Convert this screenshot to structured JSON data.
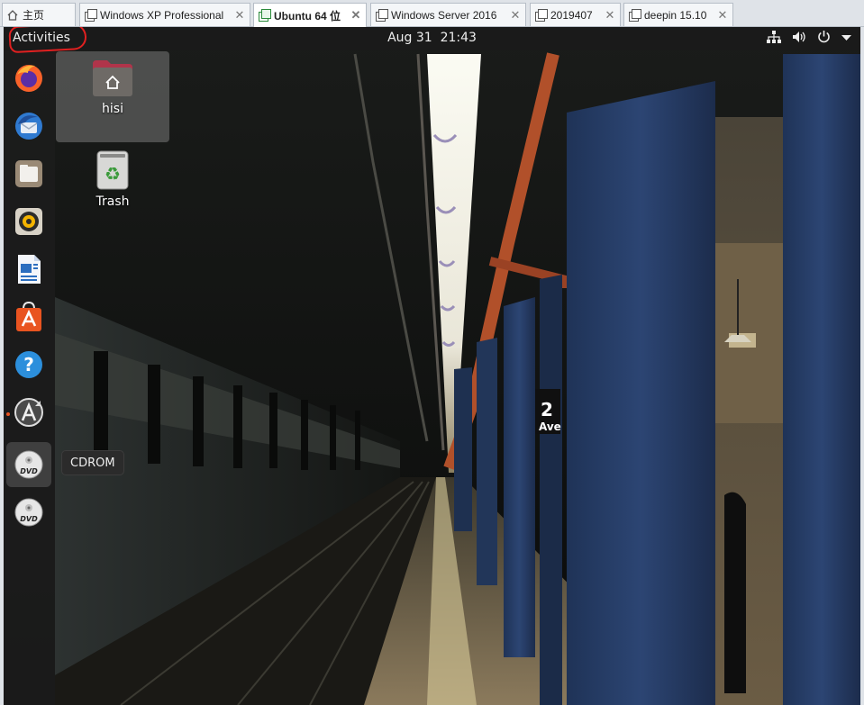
{
  "host_tabs": [
    {
      "label": "主页",
      "icon": "home-icon",
      "active": false
    },
    {
      "label": "Windows XP Professional",
      "icon": "vm-icon",
      "active": false
    },
    {
      "label": "Ubuntu 64 位",
      "icon": "vm-icon",
      "active": true
    },
    {
      "label": "Windows Server 2016",
      "icon": "vm-icon",
      "active": false
    },
    {
      "label": "2019407",
      "icon": "vm-icon",
      "active": false
    },
    {
      "label": "deepin 15.10",
      "icon": "vm-icon",
      "active": false
    }
  ],
  "topbar": {
    "activities_label": "Activities",
    "date": "Aug 31",
    "time": "21:43",
    "tray_icons": [
      "network-icon",
      "volume-icon",
      "power-icon",
      "dropdown-arrow-icon"
    ]
  },
  "dock": {
    "items": [
      {
        "name": "Firefox",
        "icon": "firefox-icon"
      },
      {
        "name": "Thunderbird",
        "icon": "thunderbird-icon"
      },
      {
        "name": "Files",
        "icon": "files-icon"
      },
      {
        "name": "Rhythmbox",
        "icon": "rhythmbox-icon"
      },
      {
        "name": "LibreOffice Writer",
        "icon": "writer-icon"
      },
      {
        "name": "Ubuntu Software",
        "icon": "software-icon"
      },
      {
        "name": "Help",
        "icon": "help-icon"
      },
      {
        "name": "Software Updater",
        "icon": "updater-icon",
        "running": true
      },
      {
        "name": "CDROM",
        "icon": "dvd-icon",
        "hovered": true
      },
      {
        "name": "CDROM",
        "icon": "dvd-icon"
      }
    ],
    "tooltip": "CDROM"
  },
  "desktop": {
    "home_folder_label": "hisi",
    "trash_label": "Trash"
  },
  "wallpaper": {
    "sign_number": "2",
    "sign_text": "Ave"
  },
  "colors": {
    "ubuntu_orange": "#e95420",
    "annotation_red": "#e02020",
    "topbar": "#1a1a1a"
  }
}
